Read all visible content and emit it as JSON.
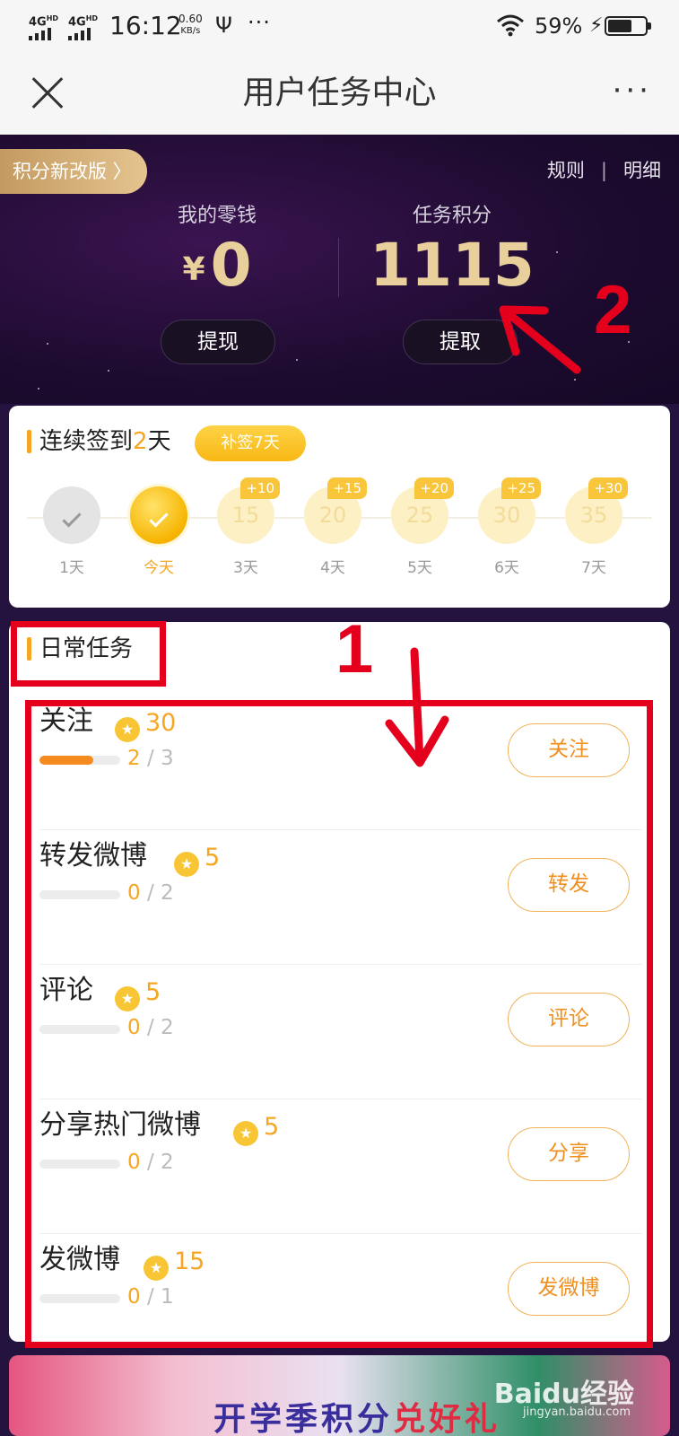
{
  "status_bar": {
    "sim1": "4G",
    "sim1_sup": "HD",
    "sim2": "4G",
    "sim2_sup": "HD",
    "time": "16:12",
    "speed_value": "0.60",
    "speed_unit": "KB/s",
    "more": "···",
    "battery_text": "59%"
  },
  "nav": {
    "title": "用户任务中心",
    "more": "···"
  },
  "hero": {
    "promo_pill": "积分新改版 〉",
    "rules_link": "规则",
    "separator": "|",
    "details_link": "明细",
    "wallet_label": "我的零钱",
    "currency_symbol": "¥",
    "wallet_value": "0",
    "points_label": "任务积分",
    "points_value": "1115",
    "withdraw_button": "提现",
    "claim_button": "提取"
  },
  "annotations": {
    "one": "1",
    "two": "2",
    "arrow_color": "#e4001c"
  },
  "checkin": {
    "title_prefix": "连续签到",
    "streak_days": "2",
    "title_suffix": "天",
    "makeup_button": "补签7天",
    "days": [
      {
        "label": "1天",
        "state": "done",
        "number": "",
        "bonus": ""
      },
      {
        "label": "今天",
        "state": "today",
        "number": "",
        "bonus": ""
      },
      {
        "label": "3天",
        "state": "future",
        "number": "15",
        "bonus": "+10"
      },
      {
        "label": "4天",
        "state": "future",
        "number": "20",
        "bonus": "+15"
      },
      {
        "label": "5天",
        "state": "future",
        "number": "25",
        "bonus": "+20"
      },
      {
        "label": "6天",
        "state": "future",
        "number": "30",
        "bonus": "+25"
      },
      {
        "label": "7天",
        "state": "future",
        "number": "35",
        "bonus": "+30"
      }
    ]
  },
  "daily_tasks": {
    "title": "日常任务",
    "tasks": [
      {
        "name": "关注",
        "points": "30",
        "done": "2",
        "sep": "/",
        "total": "3",
        "progress": 0.667,
        "button": "关注"
      },
      {
        "name": "转发微博",
        "points": "5",
        "done": "0",
        "sep": "/",
        "total": "2",
        "progress": 0,
        "button": "转发"
      },
      {
        "name": "评论",
        "points": "5",
        "done": "0",
        "sep": "/",
        "total": "2",
        "progress": 0,
        "button": "评论"
      },
      {
        "name": "分享热门微博",
        "points": "5",
        "done": "0",
        "sep": "/",
        "total": "2",
        "progress": 0,
        "button": "分享"
      },
      {
        "name": "发微博",
        "points": "15",
        "done": "0",
        "sep": "/",
        "total": "1",
        "progress": 0,
        "button": "发微博"
      }
    ]
  },
  "banner": {
    "text_a": "开学季积分",
    "text_b": "兑好礼",
    "watermark": "Baidu经验",
    "watermark_url": "jingyan.baidu.com"
  },
  "colors": {
    "accent": "#f5a623",
    "gold": "#e9cf9b",
    "hero_bg": "#1d0b2f",
    "annotation_red": "#e4001c"
  }
}
